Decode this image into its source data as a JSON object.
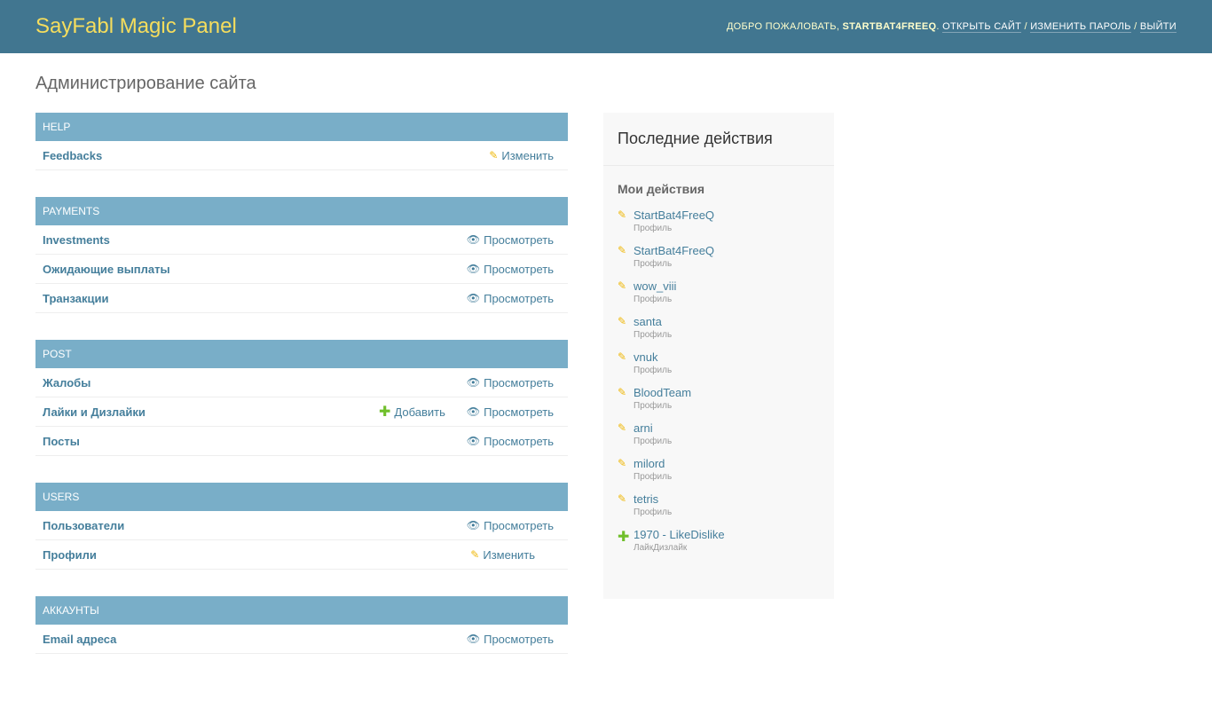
{
  "header": {
    "brand": "SayFabl Magic Panel",
    "welcome": "Добро пожаловать,",
    "username": "StartBat4FreeQ",
    "view_site": "Открыть сайт",
    "change_password": "Изменить пароль",
    "logout": "Выйти"
  },
  "title": "Администрирование сайта",
  "modules": [
    {
      "name": "Help",
      "rows": [
        {
          "name": "Feedbacks",
          "actions": [
            {
              "icon": "pencil-icon",
              "label": "Изменить"
            }
          ]
        }
      ]
    },
    {
      "name": "Payments",
      "rows": [
        {
          "name": "Investments",
          "actions": [
            {
              "icon": "eye-icon",
              "label": "Просмотреть"
            }
          ]
        },
        {
          "name": "Ожидающие выплаты",
          "actions": [
            {
              "icon": "eye-icon",
              "label": "Просмотреть"
            }
          ]
        },
        {
          "name": "Транзакции",
          "actions": [
            {
              "icon": "eye-icon",
              "label": "Просмотреть"
            }
          ]
        }
      ]
    },
    {
      "name": "Post",
      "rows": [
        {
          "name": "Жалобы",
          "actions": [
            {
              "icon": "eye-icon",
              "label": "Просмотреть"
            }
          ]
        },
        {
          "name": "Лайки и Дизлайки",
          "actions": [
            {
              "icon": "plus-icon",
              "label": "Добавить"
            },
            {
              "icon": "eye-icon",
              "label": "Просмотреть"
            }
          ]
        },
        {
          "name": "Посты",
          "actions": [
            {
              "icon": "eye-icon",
              "label": "Просмотреть"
            }
          ]
        }
      ]
    },
    {
      "name": "Users",
      "rows": [
        {
          "name": "Пользователи",
          "actions": [
            {
              "icon": "eye-icon",
              "label": "Просмотреть"
            }
          ]
        },
        {
          "name": "Профили",
          "actions": [
            {
              "icon": "pencil-icon",
              "label": "Изменить"
            }
          ],
          "pad": true
        }
      ]
    },
    {
      "name": "Аккаунты",
      "rows": [
        {
          "name": "Email адреса",
          "actions": [
            {
              "icon": "eye-icon",
              "label": "Просмотреть"
            }
          ]
        }
      ]
    }
  ],
  "sidebar": {
    "title": "Последние действия",
    "subtitle": "Мои действия",
    "actions": [
      {
        "icon": "pencil-icon",
        "title": "StartBat4FreeQ",
        "type": "Профиль"
      },
      {
        "icon": "pencil-icon",
        "title": "StartBat4FreeQ",
        "type": "Профиль"
      },
      {
        "icon": "pencil-icon",
        "title": "wow_viii",
        "type": "Профиль"
      },
      {
        "icon": "pencil-icon",
        "title": "santa",
        "type": "Профиль"
      },
      {
        "icon": "pencil-icon",
        "title": "vnuk",
        "type": "Профиль"
      },
      {
        "icon": "pencil-icon",
        "title": "BloodTeam",
        "type": "Профиль"
      },
      {
        "icon": "pencil-icon",
        "title": "arni",
        "type": "Профиль"
      },
      {
        "icon": "pencil-icon",
        "title": "milord",
        "type": "Профиль"
      },
      {
        "icon": "pencil-icon",
        "title": "tetris",
        "type": "Профиль"
      },
      {
        "icon": "plus-icon",
        "title": "1970 - LikeDislike",
        "type": "ЛайкДизлайк"
      }
    ]
  }
}
